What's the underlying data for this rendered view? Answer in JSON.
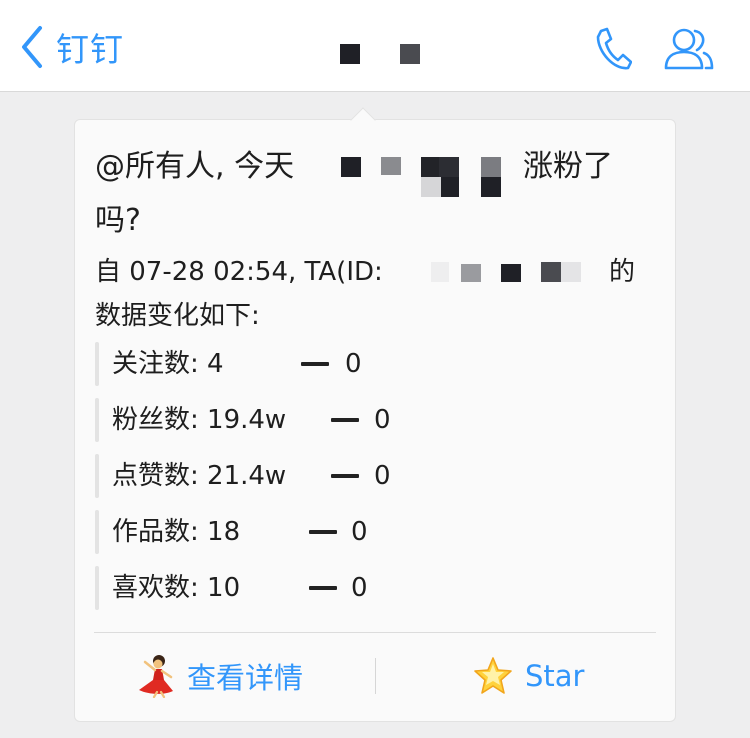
{
  "navbar": {
    "back_label": "钉钉",
    "back_icon": "chevron-left-icon",
    "right_icons": [
      "phone-icon",
      "contacts-icon"
    ],
    "accent_color": "#3296fa"
  },
  "message": {
    "headline_start": "@所有人, 今天",
    "headline_end": "涨粉了",
    "headline_line2": "吗?",
    "sub_prefix": "自 07-28 02:54, TA(ID: ",
    "sub_suffix": "的",
    "sub_line2": "数据变化如下:",
    "stats": [
      {
        "label": "关注数: 4",
        "change": "0"
      },
      {
        "label": "粉丝数: 19.4w",
        "change": "0"
      },
      {
        "label": "点赞数: 21.4w",
        "change": "0"
      },
      {
        "label": "作品数: 18",
        "change": "0"
      },
      {
        "label": "喜欢数: 10",
        "change": "0"
      }
    ]
  },
  "actions": {
    "details_label": "查看详情",
    "details_icon": "dancer-emoji-icon",
    "star_label": "Star",
    "star_icon": "star-emoji-icon"
  }
}
